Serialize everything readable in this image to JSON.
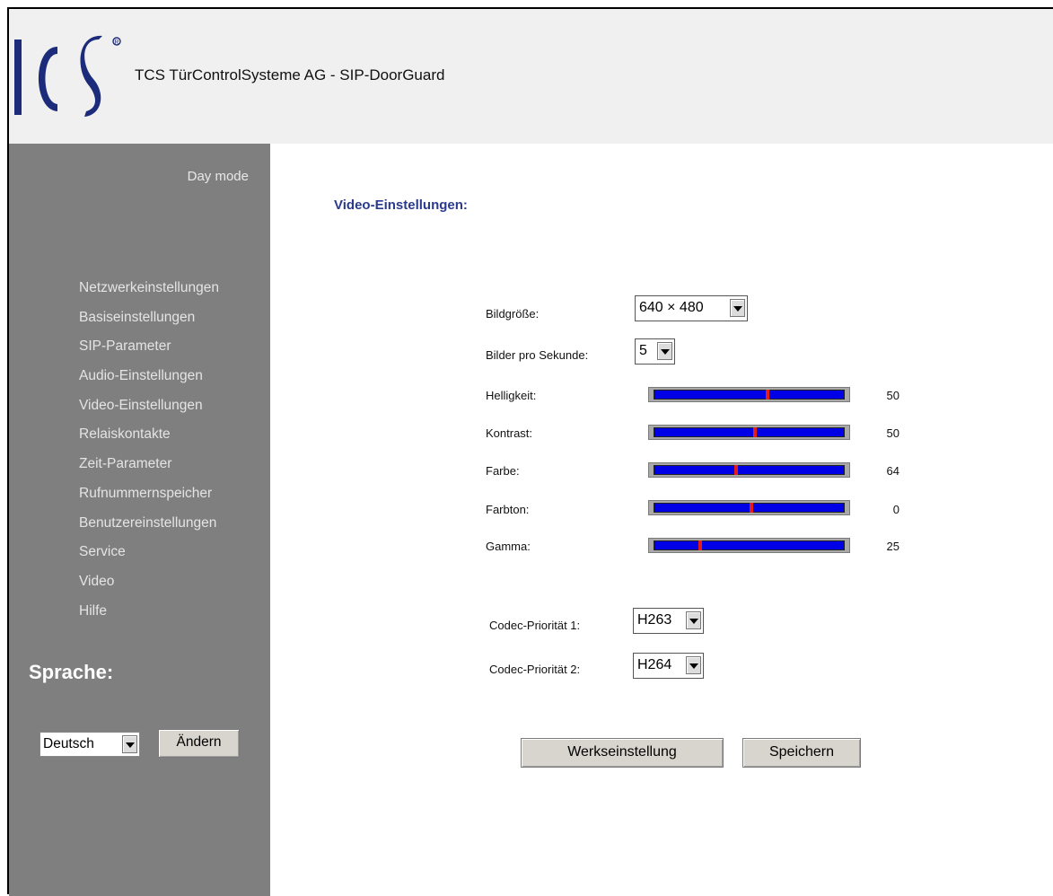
{
  "header": {
    "logo_text": "TCS",
    "title": "TCS TürControlSysteme AG - SIP-DoorGuard"
  },
  "sidebar": {
    "mode": "Day mode",
    "items": [
      {
        "label": "Netzwerkeinstellungen"
      },
      {
        "label": "Basiseinstellungen"
      },
      {
        "label": "SIP-Parameter"
      },
      {
        "label": "Audio-Einstellungen"
      },
      {
        "label": "Video-Einstellungen"
      },
      {
        "label": "Relaiskontakte"
      },
      {
        "label": "Zeit-Parameter"
      },
      {
        "label": "Rufnummernspeicher"
      },
      {
        "label": "Benutzereinstellungen"
      },
      {
        "label": "Service"
      },
      {
        "label": "Video"
      },
      {
        "label": "Hilfe"
      }
    ],
    "language_heading": "Sprache:",
    "language_value": "Deutsch",
    "change_label": "Ändern"
  },
  "main": {
    "title": "Video-Einstellungen:",
    "image_size": {
      "label": "Bildgröße:",
      "value": "640 × 480"
    },
    "fps": {
      "label": "Bilder pro Sekunde:",
      "value": "5"
    },
    "sliders": [
      {
        "label": "Helligkeit:",
        "value": "50",
        "level": 0.6
      },
      {
        "label": "Kontrast:",
        "value": "50",
        "level": 0.53
      },
      {
        "label": "Farbe:",
        "value": "64",
        "level": 0.43
      },
      {
        "label": "Farbton:",
        "value": "0",
        "level": 0.51
      },
      {
        "label": "Gamma:",
        "value": "25",
        "level": 0.24
      }
    ],
    "codec1": {
      "label": "Codec-Priorität 1:",
      "value": "H263"
    },
    "codec2": {
      "label": "Codec-Priorität 2:",
      "value": "H264"
    },
    "factory_reset_label": "Werkseinstellung",
    "save_label": "Speichern"
  },
  "colors": {
    "header_bg": "#f0f0f0",
    "sidebar_bg": "#7f7f7f",
    "title_blue": "#2a3a8c",
    "slider_track": "#0000e6",
    "slider_thumb": "#e31c1c",
    "logo_blue": "#1c2b7a"
  }
}
